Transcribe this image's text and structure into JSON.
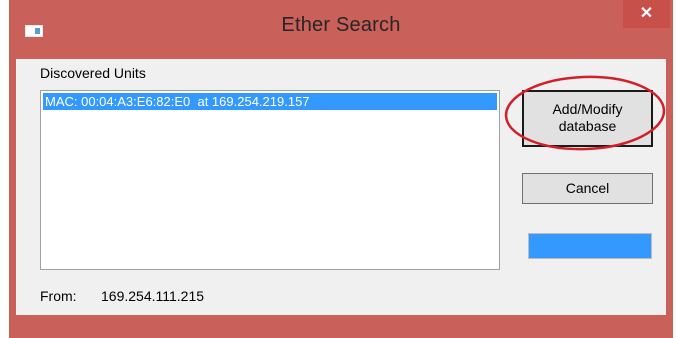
{
  "window": {
    "title": "Ether Search",
    "close_icon": "close-icon",
    "close_label": "✕"
  },
  "group": {
    "label": "Discovered Units"
  },
  "units": [
    {
      "text": "MAC: 00:04:A3:E6:82:E0  at 169.254.219.157"
    }
  ],
  "buttons": {
    "add_modify_line1": "Add/Modify",
    "add_modify_line2": "database",
    "cancel": "Cancel"
  },
  "progress": {
    "value": 1.0,
    "color": "#3399ff"
  },
  "from": {
    "label": "From:",
    "value": "169.254.111.215"
  },
  "annotation": {
    "color": "#d0202a"
  }
}
